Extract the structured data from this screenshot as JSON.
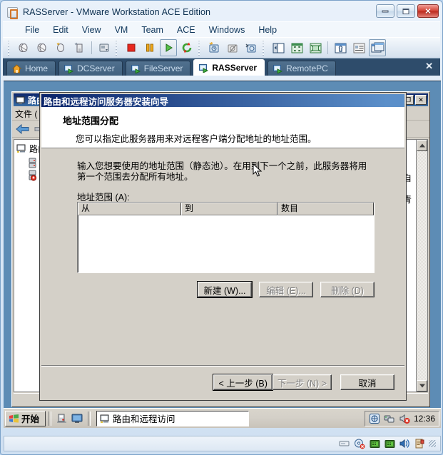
{
  "vmware": {
    "title": "RASServer - VMware Workstation ACE Edition",
    "app_icon": "vmware-icon",
    "window_buttons": {
      "minimize": "minimize-icon",
      "maximize": "maximize-icon",
      "close": "✕"
    },
    "menus": [
      "File",
      "Edit",
      "View",
      "VM",
      "Team",
      "ACE",
      "Windows",
      "Help"
    ],
    "toolbar_icons": [
      "snapshot-take-icon",
      "snapshot-revert-icon",
      "snapshot-manager-icon",
      "snapshot-delete-icon",
      "snapshot-settings-icon",
      "power-off-icon",
      "suspend-icon",
      "power-on-icon",
      "reset-icon",
      "clone-new-icon",
      "clone-icon",
      "clone-settings-icon",
      "show-sidebar-icon",
      "fit-guest-icon",
      "fullscreen-icon",
      "vm-settings-icon",
      "summary-icon",
      "console-view-icon"
    ],
    "tabs": [
      {
        "label": "Home",
        "icon": "home-icon",
        "active": false
      },
      {
        "label": "DCServer",
        "icon": "vm-icon",
        "active": false
      },
      {
        "label": "FileServer",
        "icon": "vm-icon",
        "active": false
      },
      {
        "label": "RASServer",
        "icon": "vm-icon",
        "active": true
      },
      {
        "label": "RemotePC",
        "icon": "vm-icon",
        "active": false
      }
    ],
    "tabs_close": "✕",
    "status_icons": [
      "floppy-icon",
      "cd-icon",
      "network-icon-1",
      "network-icon-2",
      "sound-icon",
      "usb-icon",
      "resize-grip"
    ]
  },
  "mmc_window": {
    "title": "路由",
    "title_icon": "console-icon",
    "menu": "文件 (",
    "toolbar_icons": [
      "back-arrow-icon",
      "forward-arrow-icon"
    ],
    "tree": [
      {
        "label": "路由",
        "icon": "computer-icon",
        "indent": 0
      },
      {
        "label": "",
        "icon": "server-icon",
        "indent": 1
      },
      {
        "label": "",
        "icon": "server-red-icon",
        "indent": 1
      }
    ],
    "right_pane_text": [
      "自",
      "青"
    ],
    "window_buttons": {
      "minimize": "_",
      "maximize": "❐",
      "close": "✕"
    }
  },
  "wizard": {
    "title": "路由和远程访问服务器安装向导",
    "heading": "地址范围分配",
    "subheading": "您可以指定此服务器用来对远程客户端分配地址的地址范围。",
    "body_text": "输入您想要使用的地址范围（静态池）。在用到下一个之前，此服务器将用第一个范围去分配所有地址。",
    "list_label": "地址范围 (A):",
    "columns": [
      "从",
      "到",
      "数目"
    ],
    "rows": [],
    "list_buttons": [
      {
        "label": "新建 (W)...",
        "enabled": true,
        "default": true
      },
      {
        "label": "编辑 (E)...",
        "enabled": false,
        "default": false
      },
      {
        "label": "删除 (D)",
        "enabled": false,
        "default": false
      }
    ],
    "nav_buttons": [
      {
        "label": "< 上一步 (B)",
        "enabled": true,
        "default": true
      },
      {
        "label": "下一步 (N) >",
        "enabled": false,
        "default": false
      },
      {
        "label": "取消",
        "enabled": true,
        "default": false
      }
    ]
  },
  "taskbar": {
    "start_label": "开始",
    "start_icon": "windows-flag-icon",
    "quick_launch": [
      "show-desktop-icon",
      "display-icon"
    ],
    "tasks": [
      {
        "label": "路由和远程访问",
        "icon": "console-icon",
        "active": true
      }
    ],
    "tray_icons": [
      "network-shield-icon",
      "network-activity-icon",
      "volume-muted-icon"
    ],
    "clock": "12:36"
  }
}
